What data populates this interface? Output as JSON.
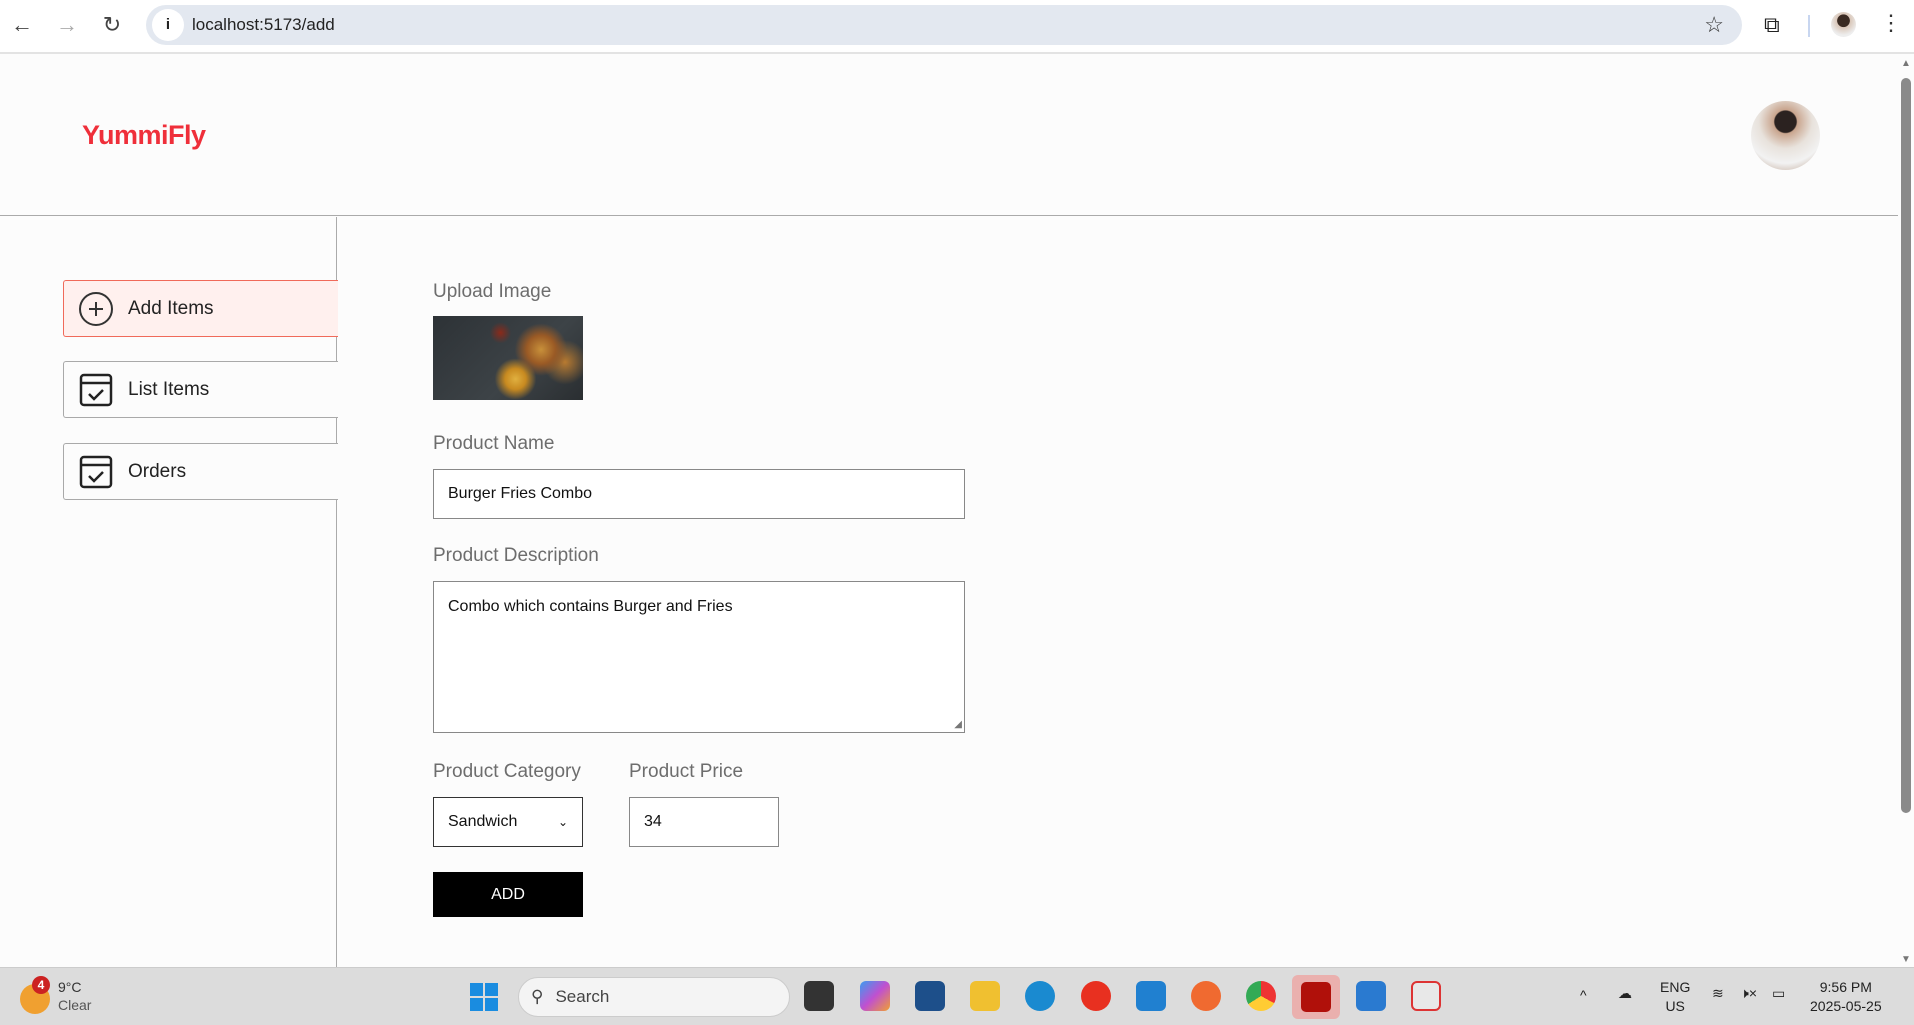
{
  "browser": {
    "url": "localhost:5173/add"
  },
  "header": {
    "logo": "YummiFly"
  },
  "sidebar": {
    "items": [
      {
        "label": "Add Items",
        "active": true
      },
      {
        "label": "List Items",
        "active": false
      },
      {
        "label": "Orders",
        "active": false
      }
    ]
  },
  "form": {
    "upload_label": "Upload Image",
    "name_label": "Product Name",
    "name_value": "Burger Fries Combo",
    "description_label": "Product Description",
    "description_value": "Combo which contains Burger and Fries",
    "category_label": "Product Category",
    "category_value": "Sandwich",
    "price_label": "Product Price",
    "price_value": "34",
    "submit_label": "ADD"
  },
  "taskbar": {
    "weather_temp": "9°C",
    "weather_desc": "Clear",
    "weather_badge": "4",
    "search_placeholder": "Search",
    "lang": "ENG",
    "region": "US",
    "time": "9:56 PM",
    "date": "2025-05-25"
  },
  "colors": {
    "brand": "#ef2f3a",
    "active_bg": "#fff0ee",
    "active_border": "#f06a5a"
  }
}
